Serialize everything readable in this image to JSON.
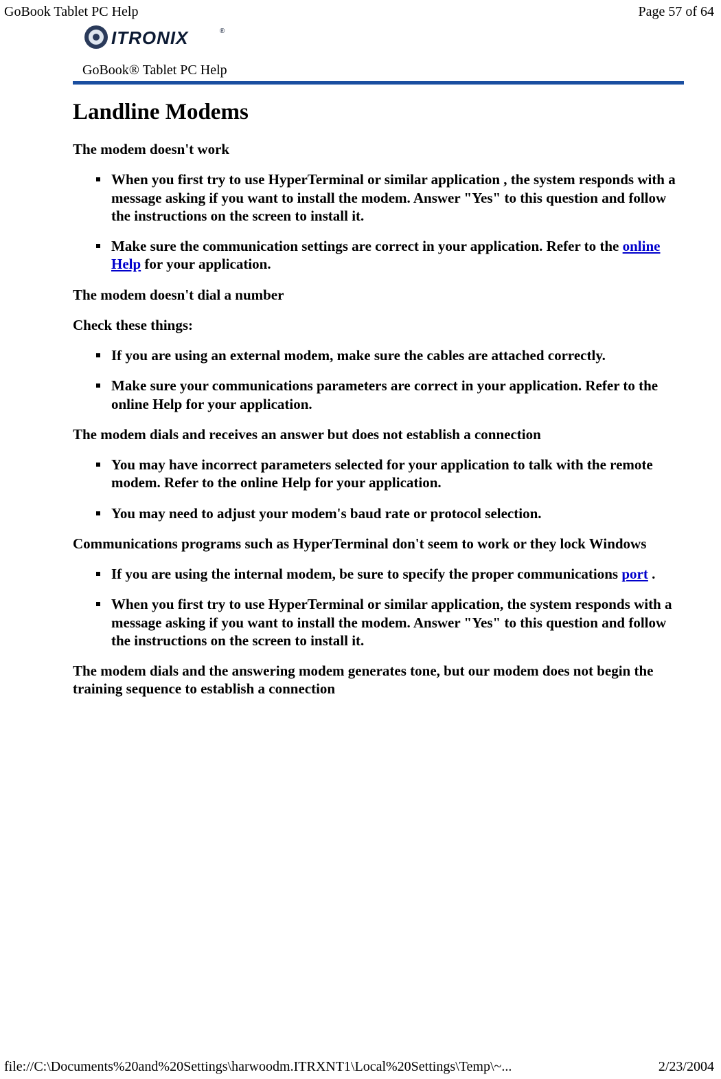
{
  "header": {
    "left": "GoBook Tablet PC Help",
    "right": "Page 57 of 64"
  },
  "footer": {
    "left": "file://C:\\Documents%20and%20Settings\\harwoodm.ITRXNT1\\Local%20Settings\\Temp\\~...",
    "right": "2/23/2004"
  },
  "brand": {
    "product_line": "GoBook® Tablet PC Help",
    "logo_alt": "ITRONIX"
  },
  "title": "Landline Modems",
  "sections": [
    {
      "heading": "The modem doesn't work",
      "items": [
        {
          "pre": "When you first try to use HyperTerminal or similar application , the system responds with a message asking if you want to install the modem. Answer \"Yes\" to this question and follow the instructions on the screen to install it."
        },
        {
          "pre": "Make sure the communication settings are correct in your application. Refer to the ",
          "link": "online Help",
          "post": " for your application."
        }
      ]
    },
    {
      "heading": "The modem doesn't dial a number",
      "items": []
    },
    {
      "heading": "Check these things:",
      "items": [
        {
          "pre": "If you are using an external modem, make sure the cables are attached correctly."
        },
        {
          "pre": "Make sure your communications parameters are correct in your application. Refer to the online Help for your application."
        }
      ]
    },
    {
      "heading": "The modem dials and receives an answer but does not establish a connection",
      "items": [
        {
          "pre": "You may have incorrect parameters selected for your application to talk with the remote modem. Refer to the online Help for your application."
        },
        {
          "pre": "You may need to adjust your modem's baud rate or protocol selection."
        }
      ]
    },
    {
      "heading": "Communications programs such as HyperTerminal don't seem to work or they lock Windows",
      "items": [
        {
          "pre": "If you are using the internal modem, be sure to specify the proper communications ",
          "link": "port",
          "post": " ."
        },
        {
          "pre": "When you first try to use HyperTerminal or similar application, the system responds with a message asking if you want to install the modem. Answer \"Yes\" to this question and follow the instructions on the screen to install it."
        }
      ]
    },
    {
      "heading": "The modem dials and the answering modem generates tone, but our modem does not begin the training sequence to establish a connection",
      "items": []
    }
  ]
}
